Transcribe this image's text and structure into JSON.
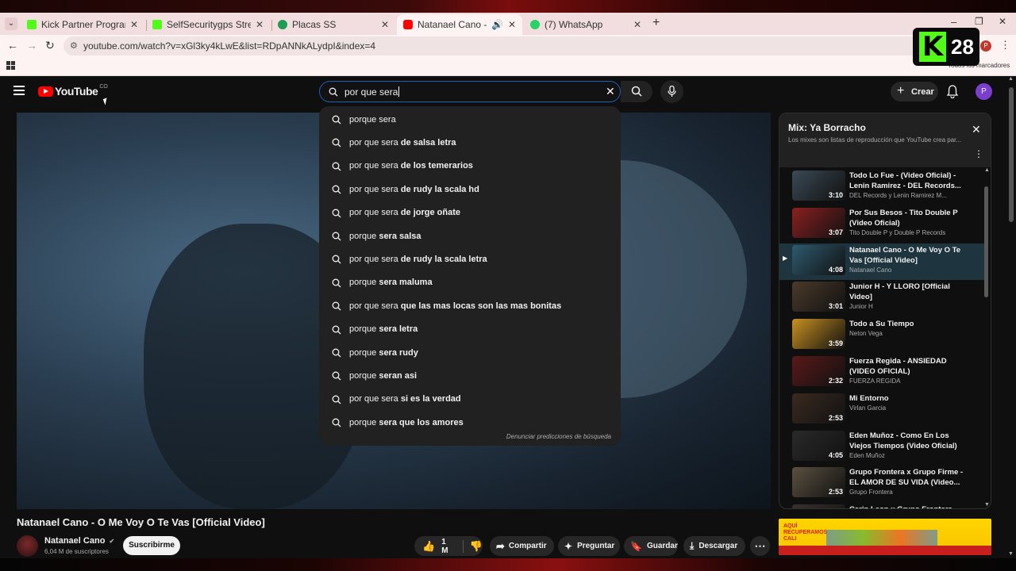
{
  "browser": {
    "tabs": [
      {
        "title": "Kick Partner Program - Kick Da",
        "color": "#53fc18",
        "active": false
      },
      {
        "title": "SelfSecuritygps Stream - Watch",
        "color": "#53fc18",
        "active": false
      },
      {
        "title": "Placas SS",
        "color": "#1f9d55",
        "active": false
      },
      {
        "title": "Natanael Cano - O Me Voy",
        "color": "#ff0000",
        "active": true
      },
      {
        "title": "(7) WhatsApp",
        "color": "#25d366",
        "active": false
      }
    ],
    "url": "youtube.com/watch?v=xGl3ky4kLwE&list=RDpANNkALydpI&index=4",
    "bookmarks_label": "Todos los marcadores",
    "profile_initial": "P"
  },
  "overlay": {
    "badge_number": "28"
  },
  "youtube": {
    "logo_text": "YouTube",
    "country": "CO",
    "search_query": "por que sera",
    "create_label": "Crear",
    "avatar_initial": "P",
    "suggestions": [
      {
        "prefix": "porque sera",
        "suffix": ""
      },
      {
        "prefix": "por que sera",
        "suffix": " de salsa letra"
      },
      {
        "prefix": "por que sera",
        "suffix": " de los temerarios"
      },
      {
        "prefix": "por que sera",
        "suffix": " de rudy la scala hd"
      },
      {
        "prefix": "por que sera",
        "suffix": " de jorge oñate"
      },
      {
        "prefix": "porque",
        "suffix": " sera salsa"
      },
      {
        "prefix": "por que sera",
        "suffix": " de rudy la scala letra"
      },
      {
        "prefix": "porque",
        "suffix": " sera maluma"
      },
      {
        "prefix": "por que sera",
        "suffix": " que las mas locas son las mas bonitas"
      },
      {
        "prefix": "porque",
        "suffix": " sera letra"
      },
      {
        "prefix": "porque",
        "suffix": " sera rudy"
      },
      {
        "prefix": "porque",
        "suffix": " seran asi"
      },
      {
        "prefix": "por que sera",
        "suffix": " si es la verdad"
      },
      {
        "prefix": "porque",
        "suffix": " sera que los amores"
      }
    ],
    "report_label": "Denunciar predicciones de búsqueda",
    "video": {
      "title": "Natanael Cano - O Me Voy O Te Vas [Official Video]",
      "channel": "Natanael Cano",
      "subscribers": "6,04 M de suscriptores",
      "subscribe_label": "Suscribirme",
      "likes": "1 M",
      "share_label": "Compartir",
      "ask_label": "Preguntar",
      "save_label": "Guardar",
      "download_label": "Descargar"
    },
    "playlist": {
      "title": "Mix: Ya Borracho",
      "subtitle": "Los mixes son listas de reproducción que YouTube crea par...",
      "items": [
        {
          "title": "Todo Lo Fue - (Video Oficial) - Lenin Ramirez - DEL Records...",
          "channel": "DEL Records y Lenin Ramirez M...",
          "duration": "3:10",
          "thumb": "#3b4a55"
        },
        {
          "title": "Por Sus Besos - Tito Double P (Video Oficial)",
          "channel": "Tito Double P y Double P Records",
          "duration": "3:07",
          "thumb": "#8a2020"
        },
        {
          "title": "Natanael Cano - O Me Voy O Te Vas [Official Video]",
          "channel": "Natanael Cano",
          "duration": "4:08",
          "thumb": "#2e5a6e"
        },
        {
          "title": "Junior H - Y LLORO [Official Video]",
          "channel": "Junior H",
          "duration": "3:01",
          "thumb": "#4a3a2a"
        },
        {
          "title": "Todo a Su Tiempo",
          "channel": "Neton Vega",
          "duration": "3:59",
          "thumb": "#c89020"
        },
        {
          "title": "Fuerza Regida - ANSIEDAD (VIDEO OFICIAL)",
          "channel": "FUERZA REGIDA",
          "duration": "2:32",
          "thumb": "#5a1818"
        },
        {
          "title": "Mi Entorno",
          "channel": "Virlan Garcia",
          "duration": "2:53",
          "thumb": "#3a2a20"
        },
        {
          "title": "Eden Muñoz - Como En Los Viejos Tiempos (Video Oficial)",
          "channel": "Eden Muñoz",
          "duration": "4:05",
          "thumb": "#2a2a2a"
        },
        {
          "title": "Grupo Frontera x Grupo Firme - EL AMOR DE SU VIDA (Video...",
          "channel": "Grupo Frontera",
          "duration": "2:53",
          "thumb": "#5a5040"
        },
        {
          "title": "Carin Leon x Grupo Frontera -",
          "channel": "",
          "duration": "",
          "thumb": "#3a3030"
        }
      ]
    },
    "ad_text": "AQUÍ RECUPERAMOS CALI"
  }
}
